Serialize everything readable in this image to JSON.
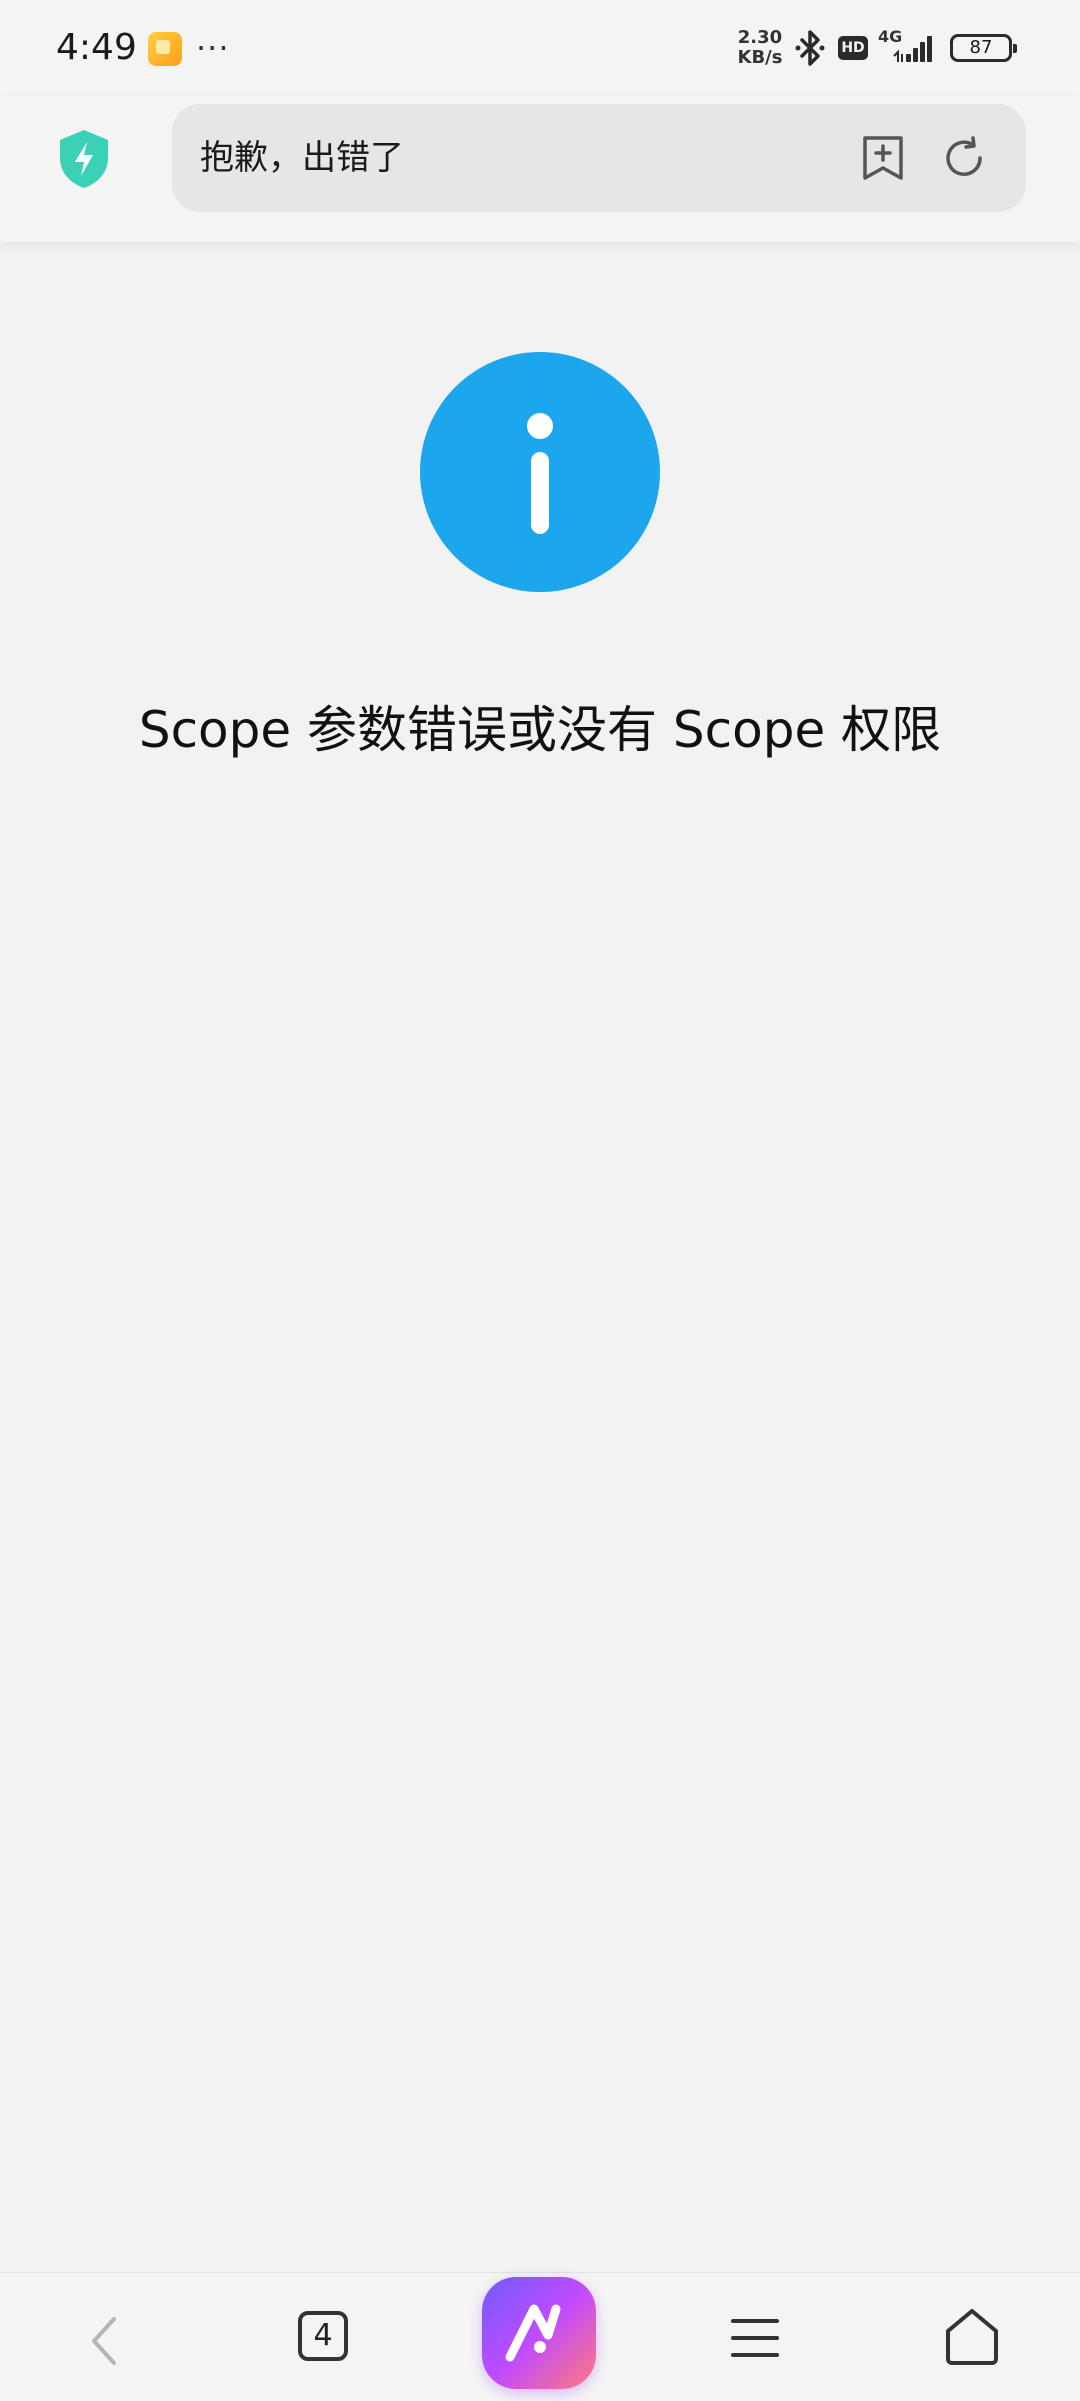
{
  "status_bar": {
    "time": "4:49",
    "more": "···",
    "net_speed_value": "2.30",
    "net_speed_unit": "KB/s",
    "hd_label": "HD",
    "network_label": "4G",
    "battery": "87",
    "icons": [
      "app-notification-icon",
      "bluetooth-icon",
      "hd-icon",
      "signal-icon",
      "battery-icon"
    ]
  },
  "browser": {
    "page_title": "抱歉，出错了",
    "icons": [
      "security-shield-icon",
      "bookmark-add-icon",
      "reload-icon"
    ],
    "accent": "#3ad1b6"
  },
  "main": {
    "icon": "info-icon",
    "icon_color": "#1ca6ee",
    "message": "Scope 参数错误或没有 Scope 权限"
  },
  "bottom_nav": {
    "tab_count": "4",
    "items": [
      "back-icon",
      "tabs-counter",
      "ai-assistant-icon",
      "menu-icon",
      "home-icon"
    ]
  }
}
